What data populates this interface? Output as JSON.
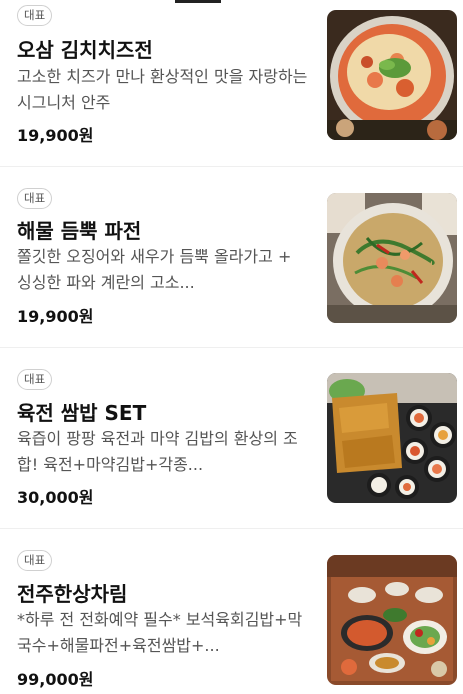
{
  "menu": {
    "items": [
      {
        "badge": "대표",
        "name": "오삼 김치치즈전",
        "description": "고소한 치즈가 만나 환상적인 맛을 자랑하는 시그니처 안주",
        "price": "19,900원",
        "image_alt": "kimchi-cheese-pancake-photo"
      },
      {
        "badge": "대표",
        "name": "해물 듬뿍 파전",
        "description": "쫄깃한 오징어와 새우가 듬뿍 올라가고 + 싱싱한 파와 계란의 고소...",
        "price": "19,900원",
        "image_alt": "seafood-green-onion-pancake-photo"
      },
      {
        "badge": "대표",
        "name": "육전 쌈밥 SET",
        "description": "육즙이 팡팡 육전과 마약 김밥의 환상의 조합! 육전+마약김밥+각종...",
        "price": "30,000원",
        "image_alt": "beef-pancake-ssambap-set-photo"
      },
      {
        "badge": "대표",
        "name": "전주한상차림",
        "description": "*하루 전 전화예약 필수* 보석육회김밥+막국수+해물파전+육전쌈밥+...",
        "price": "99,000원",
        "image_alt": "jeonju-full-table-photo"
      }
    ]
  },
  "colors": {
    "text_primary": "#111111",
    "text_secondary": "#555555",
    "badge_border": "#d0d0d0",
    "divider": "#efefef"
  }
}
